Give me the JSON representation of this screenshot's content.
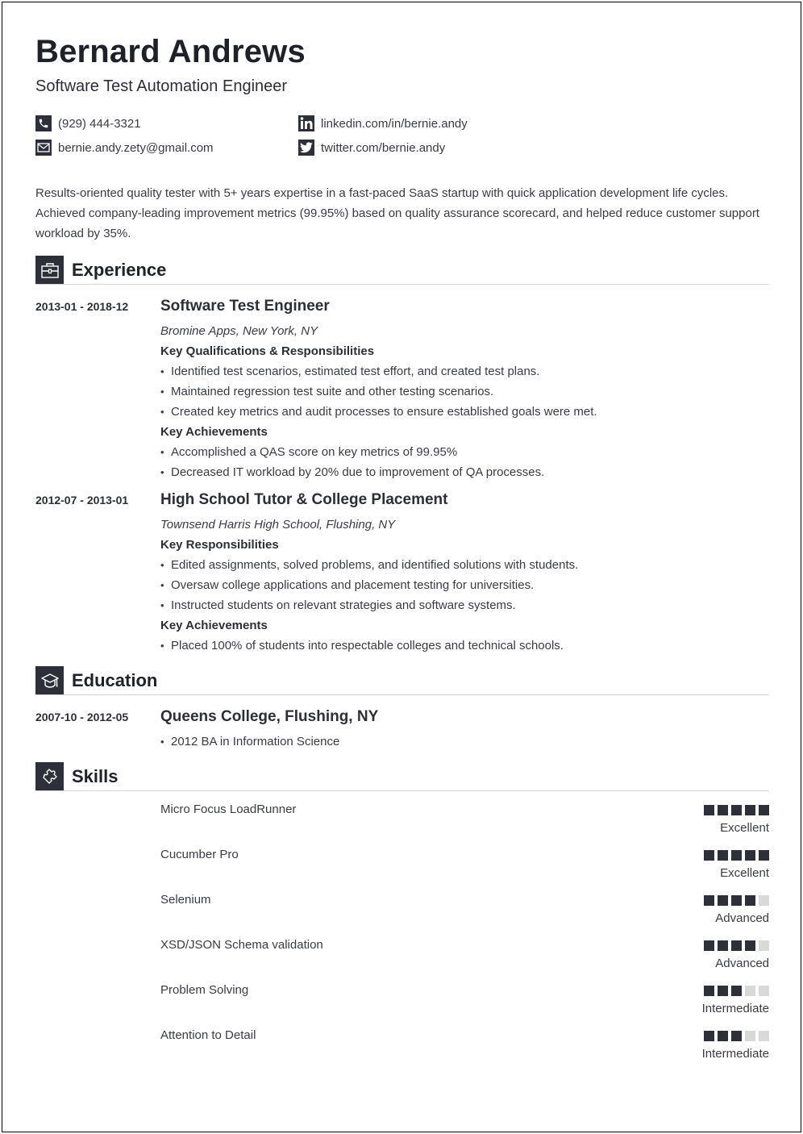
{
  "header": {
    "name": "Bernard Andrews",
    "title": "Software Test Automation Engineer"
  },
  "contacts": {
    "phone": {
      "icon": "phone-icon",
      "value": "(929) 444-3321"
    },
    "email": {
      "icon": "mail-icon",
      "value": "bernie.andy.zety@gmail.com"
    },
    "linkedin": {
      "icon": "linkedin-icon",
      "value": "linkedin.com/in/bernie.andy"
    },
    "twitter": {
      "icon": "twitter-icon",
      "value": "twitter.com/bernie.andy"
    }
  },
  "summary": "Results-oriented quality tester with 5+ years expertise in a fast-paced SaaS startup with quick application development life cycles. Achieved company-leading improvement metrics (99.95%) based on quality assurance scorecard, and helped reduce customer support workload by 35%.",
  "sections": {
    "experience": {
      "title": "Experience",
      "icon": "briefcase-icon"
    },
    "education": {
      "title": "Education",
      "icon": "graduation-cap-icon"
    },
    "skills": {
      "title": "Skills",
      "icon": "puzzle-piece-icon"
    }
  },
  "experience": [
    {
      "dates": "2013-01 - 2018-12",
      "role": "Software Test Engineer",
      "company": "Bromine Apps, New York, NY",
      "groups": [
        {
          "heading": "Key Qualifications & Responsibilities",
          "items": [
            "Identified test scenarios, estimated test effort, and created test plans.",
            "Maintained regression test suite and other testing scenarios.",
            "Created key metrics and audit processes to ensure established goals were met."
          ]
        },
        {
          "heading": "Key Achievements",
          "items": [
            "Accomplished a QAS score on key metrics of 99.95%",
            "Decreased IT workload by 20% due to improvement of QA processes."
          ]
        }
      ]
    },
    {
      "dates": "2012-07 - 2013-01",
      "role": "High School Tutor & College Placement",
      "company": "Townsend Harris High School, Flushing, NY",
      "groups": [
        {
          "heading": "Key Responsibilities",
          "items": [
            "Edited assignments, solved problems, and identified solutions with students.",
            "Oversaw college applications and placement testing for universities.",
            "Instructed students on relevant strategies and software systems."
          ]
        },
        {
          "heading": "Key Achievements",
          "items": [
            "Placed 100% of students into respectable colleges and technical schools."
          ]
        }
      ]
    }
  ],
  "education": [
    {
      "dates": "2007-10 - 2012-05",
      "school": "Queens College, Flushing, NY",
      "items": [
        "2012 BA in Information Science"
      ]
    }
  ],
  "skills": [
    {
      "name": "Micro Focus LoadRunner",
      "rating": 5,
      "max": 5,
      "level": "Excellent"
    },
    {
      "name": "Cucumber Pro",
      "rating": 5,
      "max": 5,
      "level": "Excellent"
    },
    {
      "name": "Selenium",
      "rating": 4,
      "max": 5,
      "level": "Advanced"
    },
    {
      "name": "XSD/JSON Schema validation",
      "rating": 4,
      "max": 5,
      "level": "Advanced"
    },
    {
      "name": "Problem Solving",
      "rating": 3,
      "max": 5,
      "level": "Intermediate"
    },
    {
      "name": "Attention to Detail",
      "rating": 3,
      "max": 5,
      "level": "Intermediate"
    }
  ]
}
